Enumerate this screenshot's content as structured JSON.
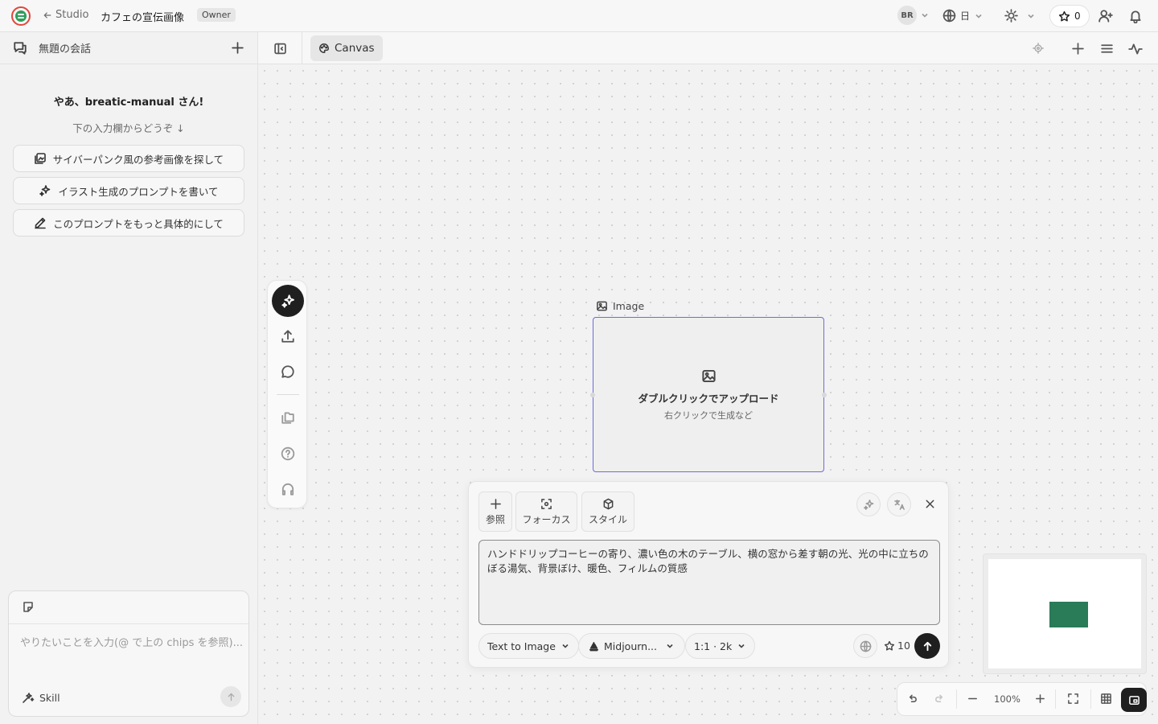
{
  "topbar": {
    "back_label": "Studio",
    "project_title": "カフェの宣伝画像",
    "role_badge": "Owner",
    "avatar_initials": "BR",
    "language": "日",
    "credits": "0"
  },
  "sidebar": {
    "conversation_title": "無題の会話",
    "greeting": "やあ、breatic-manual さん!",
    "subtext": "下の入力欄からどうぞ ↓",
    "chips": [
      {
        "label": "サイバーパンク風の参考画像を探して",
        "icon": "image-search-icon"
      },
      {
        "label": "イラスト生成のプロンプトを書いて",
        "icon": "sparkles-icon"
      },
      {
        "label": "このプロンプトをもっと具体的にして",
        "icon": "pencil-icon"
      }
    ],
    "chat_placeholder": "やりたいことを入力(@ で上の chips を参照)...",
    "skill_label": "Skill"
  },
  "canvas_header": {
    "tab_label": "Canvas"
  },
  "image_node": {
    "label": "Image",
    "title": "ダブルクリックでアップロード",
    "subtitle": "右クリックで生成など"
  },
  "prompt_panel": {
    "buttons": [
      {
        "label": "参照",
        "icon": "plus-icon"
      },
      {
        "label": "フォーカス",
        "icon": "focus-icon"
      },
      {
        "label": "スタイル",
        "icon": "box-icon"
      }
    ],
    "prompt_text": "ハンドドリップコーヒーの寄り、濃い色の木のテーブル、横の窓から差す朝の光、光の中に立ちのぼる湯気、背景ぼけ、暖色、フィルムの質感",
    "mode": "Text to Image",
    "model": "Midjourn...",
    "ratio": "1:1 · 2k",
    "cost": "10"
  },
  "zoom": {
    "level": "100%"
  },
  "colors": {
    "accent_node_border": "#6e6bd9",
    "minimap_node": "#2a7b58",
    "logo_red": "#e2453c",
    "logo_green": "#2f9e5b"
  }
}
